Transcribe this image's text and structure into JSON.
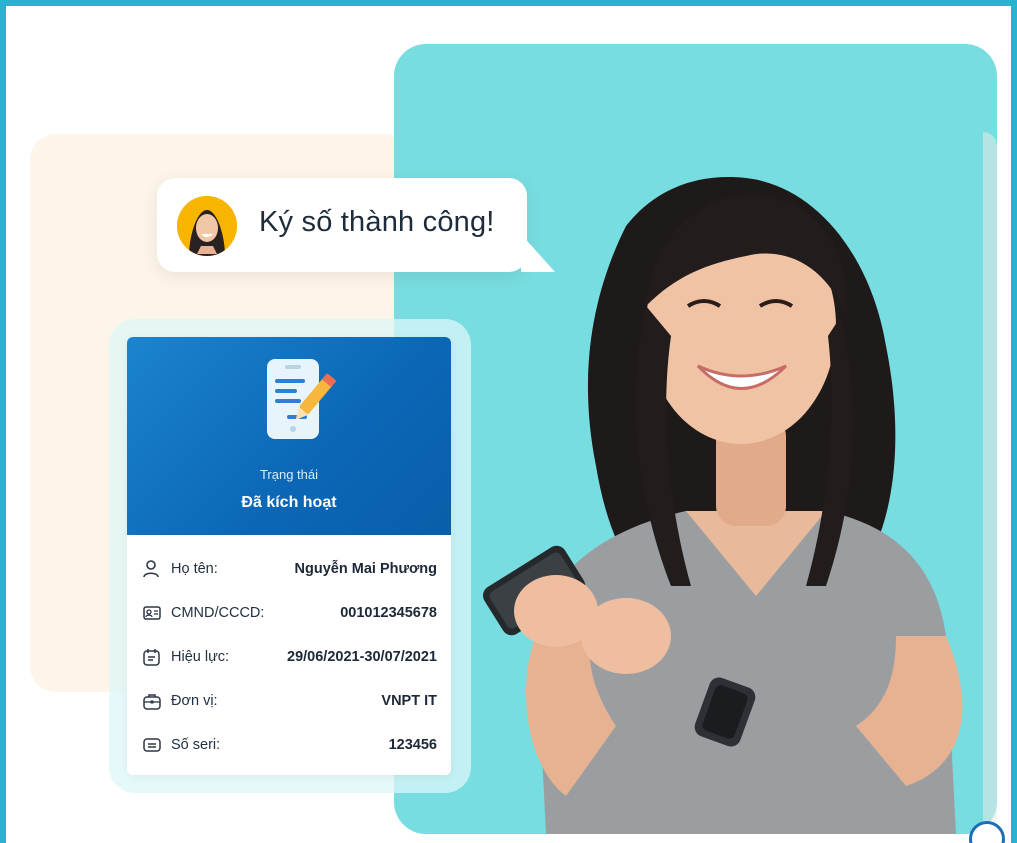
{
  "bubble": {
    "message": "Ký số thành công!"
  },
  "card": {
    "status_label": "Trạng thái",
    "status_value": "Đã kích hoạt",
    "rows": [
      {
        "icon": "person-icon",
        "label": "Họ tên:",
        "value": "Nguyễn Mai Phương"
      },
      {
        "icon": "id-card-icon",
        "label": "CMND/CCCD:",
        "value": "001012345678"
      },
      {
        "icon": "calendar-icon",
        "label": "Hiệu lực:",
        "value": "29/06/2021-30/07/2021"
      },
      {
        "icon": "briefcase-icon",
        "label": "Đơn vị:",
        "value": "VNPT IT"
      },
      {
        "icon": "serial-icon",
        "label": "Số seri:",
        "value": "123456"
      }
    ]
  },
  "colors": {
    "frame_border": "#2ab3d1",
    "teal_panel": "#78dde0",
    "cream_panel": "#fdf5ea",
    "card_header": "#0b67b6"
  }
}
